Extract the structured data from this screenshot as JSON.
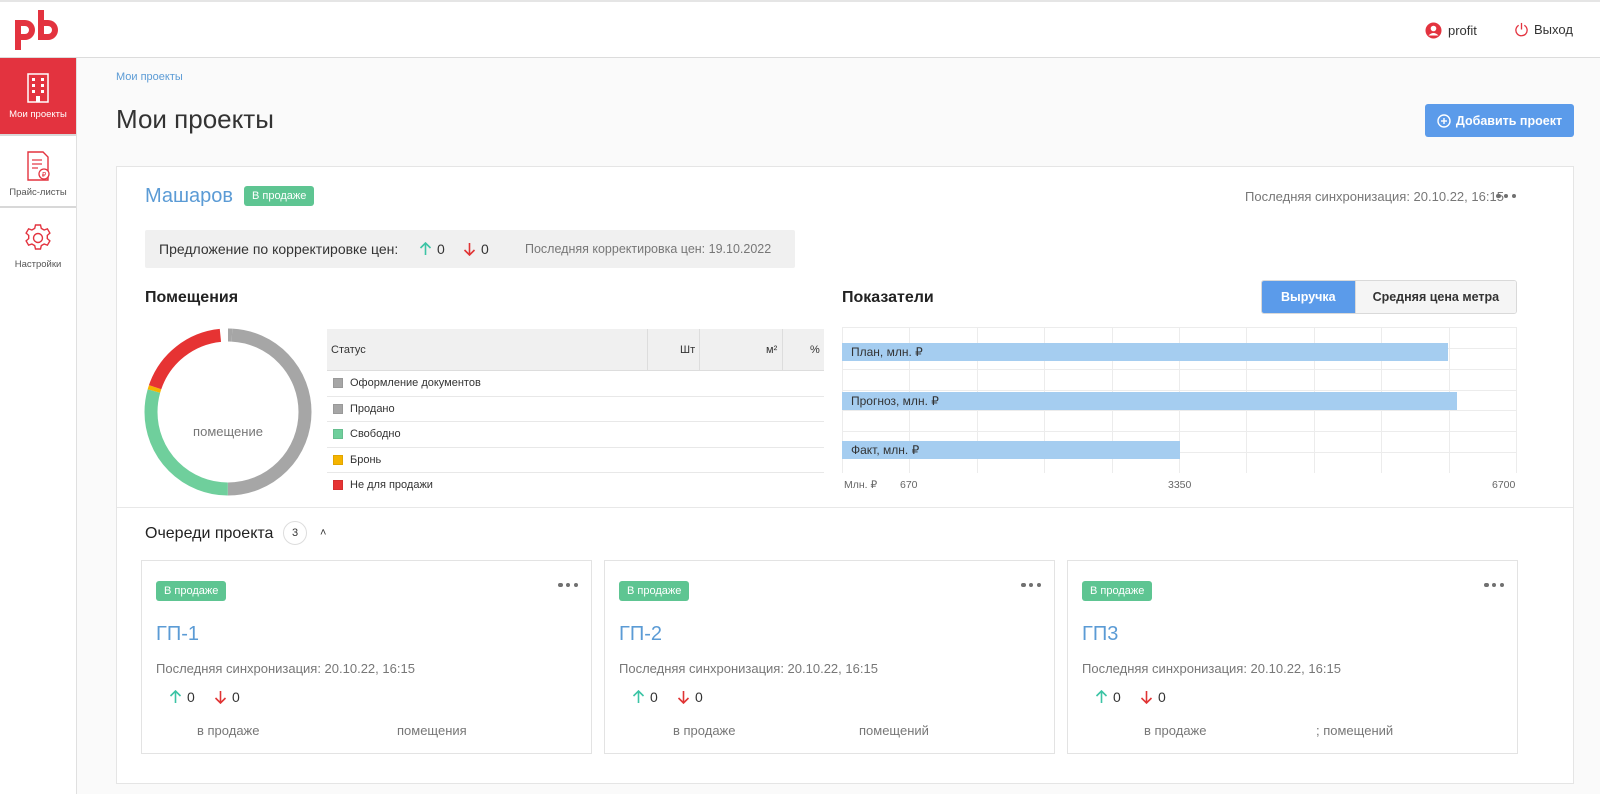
{
  "header": {
    "user_name": "profit",
    "logout_label": "Выход"
  },
  "sidebar": {
    "items": [
      {
        "label": "Мои проекты",
        "icon": "building-icon"
      },
      {
        "label": "Прайс-листы",
        "icon": "price-list-icon"
      },
      {
        "label": "Настройки",
        "icon": "gear-icon"
      }
    ]
  },
  "breadcrumb": "Мои проекты",
  "page_title": "Мои проекты",
  "add_project_label": "Добавить проект",
  "project": {
    "name": "Машаров",
    "status": "В продаже",
    "sync": "Последняя синхронизация: 20.10.22, 16:15",
    "price_proposal_label": "Предложение по корректировке цен:",
    "up_count": "0",
    "down_count": "0",
    "last_correction": "Последняя корректировка цен: 19.10.2022"
  },
  "rooms": {
    "title": "Помещения",
    "donut_label": "помещение",
    "columns": {
      "status": "Статус",
      "pcs": "Шт",
      "area": "м²",
      "pct": "%"
    },
    "rows": [
      {
        "label": "Оформление документов",
        "color": "#a6a6a6"
      },
      {
        "label": "Продано",
        "color": "#a6a6a6"
      },
      {
        "label": "Свободно",
        "color": "#6fcf9c"
      },
      {
        "label": "Бронь",
        "color": "#f5b400"
      },
      {
        "label": "Не для продажи",
        "color": "#e63333"
      }
    ]
  },
  "indicators": {
    "title": "Показатели",
    "tab_revenue": "Выручка",
    "tab_avg_price": "Средняя цена метра"
  },
  "chart_data": {
    "type": "bar",
    "orientation": "horizontal",
    "categories": [
      "План, млн. ₽",
      "Прогноз, млн. ₽",
      "Факт, млн. ₽"
    ],
    "values": [
      6020,
      6100,
      3350
    ],
    "xlabel": "Млн. ₽",
    "tick_labels": [
      "670",
      "3350",
      "6700"
    ],
    "xlim": [
      0,
      6700
    ],
    "grid": true,
    "bar_color": "#a5cdf0"
  },
  "queues": {
    "title": "Очереди проекта",
    "count": "3",
    "chevron": "˄",
    "items": [
      {
        "name": "ГП-1",
        "status": "В продаже",
        "sync": "Последняя синхронизация: 20.10.22, 16:15",
        "up": "0",
        "down": "0",
        "foot_left": "в продаже",
        "foot_right": "помещения"
      },
      {
        "name": "ГП-2",
        "status": "В продаже",
        "sync": "Последняя синхронизация: 20.10.22, 16:15",
        "up": "0",
        "down": "0",
        "foot_left": "в продаже",
        "foot_right": "помещений"
      },
      {
        "name": "ГП3",
        "status": "В продаже",
        "sync": "Последняя синхронизация: 20.10.22, 16:15",
        "up": "0",
        "down": "0",
        "foot_left": "в продаже",
        "foot_right": "; помещений"
      }
    ]
  },
  "colors": {
    "accent_red": "#e3333f",
    "accent_blue": "#5b9bea",
    "link_blue": "#5b9bd5",
    "status_green": "#5ec592",
    "up_green": "#3cc4a5",
    "down_red": "#e03434"
  }
}
